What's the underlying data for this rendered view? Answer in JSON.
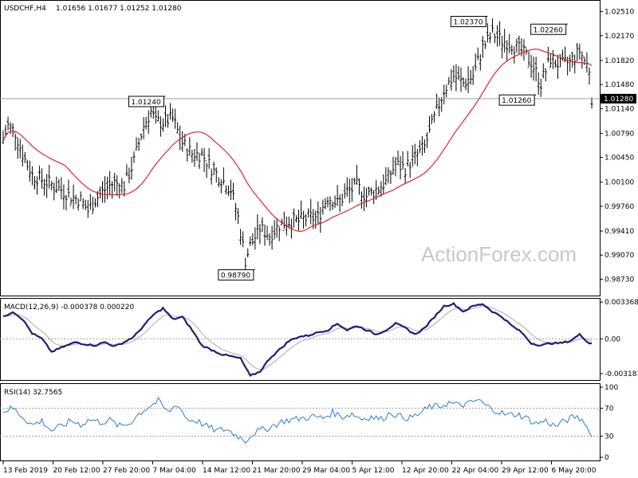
{
  "chart_data": {
    "type": "ohlc",
    "symbol_label": "USDCHF,H4",
    "ohlc_label": "1.01656 1.01677 1.01252 1.01280",
    "watermark": "ActionForex.com",
    "colors": {
      "bars": "#000000",
      "ma": "#e0262b",
      "macd": "#1c1c78",
      "signal": "#aaaaaa",
      "rsi": "#2c7cd6",
      "grid": "#a0a0a0"
    },
    "x_labels": [
      "13 Feb 2019",
      "20 Feb 12:00",
      "27 Feb 20:00",
      "7 Mar 04:00",
      "14 Mar 12:00",
      "21 Mar 20:00",
      "29 Mar 04:00",
      "5 Apr 12:00",
      "12 Apr 20:00",
      "22 Apr 04:00",
      "29 Apr 12:00",
      "6 May 20:00"
    ],
    "price": {
      "ylim": [
        0.9851,
        1.0264
      ],
      "tick_labels": [
        "1.02510",
        "1.02170",
        "1.01820",
        "1.01480",
        "1.01140",
        "1.00790",
        "1.00450",
        "1.00100",
        "0.99760",
        "0.99410",
        "0.99070",
        "0.98730"
      ],
      "last_label": "1.01280",
      "last_value": 1.0128,
      "anchors": [
        [
          0,
          1.007
        ],
        [
          2,
          1.009
        ],
        [
          5,
          1.008
        ],
        [
          8,
          1.005
        ],
        [
          12,
          1.002
        ],
        [
          18,
          1.001
        ],
        [
          24,
          1.0
        ],
        [
          28,
          0.999
        ],
        [
          32,
          0.9985
        ],
        [
          35,
          0.997
        ],
        [
          38,
          0.9985
        ],
        [
          42,
          1.0
        ],
        [
          46,
          1.001
        ],
        [
          50,
          1.0005
        ],
        [
          54,
          1.004
        ],
        [
          58,
          1.009
        ],
        [
          61,
          1.011
        ],
        [
          63,
          1.0095
        ],
        [
          66,
          1.0095
        ],
        [
          70,
          1.01
        ],
        [
          74,
          1.0065
        ],
        [
          78,
          1.005
        ],
        [
          82,
          1.005
        ],
        [
          86,
          1.003
        ],
        [
          90,
          1.0015
        ],
        [
          94,
          1.0
        ],
        [
          97,
          0.996
        ],
        [
          100,
          0.99
        ],
        [
          102,
          0.992
        ],
        [
          106,
          0.9945
        ],
        [
          110,
          0.9935
        ],
        [
          114,
          0.995
        ],
        [
          118,
          0.9955
        ],
        [
          122,
          0.9955
        ],
        [
          126,
          0.996
        ],
        [
          130,
          0.996
        ],
        [
          134,
          0.999
        ],
        [
          138,
          0.998
        ],
        [
          142,
          0.9995
        ],
        [
          146,
          1.0005
        ],
        [
          150,
          0.999
        ],
        [
          154,
          1.0
        ],
        [
          158,
          1.001
        ],
        [
          162,
          1.0035
        ],
        [
          166,
          1.003
        ],
        [
          170,
          1.0045
        ],
        [
          174,
          1.006
        ],
        [
          178,
          1.01
        ],
        [
          182,
          1.014
        ],
        [
          186,
          1.016
        ],
        [
          190,
          1.015
        ],
        [
          194,
          1.016
        ],
        [
          198,
          1.02
        ],
        [
          202,
          1.022
        ],
        [
          206,
          1.021
        ],
        [
          210,
          1.0205
        ],
        [
          214,
          1.0195
        ],
        [
          218,
          1.018
        ],
        [
          222,
          1.015
        ],
        [
          226,
          1.0185
        ],
        [
          230,
          1.0175
        ],
        [
          234,
          1.018
        ],
        [
          238,
          1.0195
        ],
        [
          242,
          1.017
        ],
        [
          243,
          1.013
        ]
      ],
      "annotations": [
        {
          "text": "1.02370",
          "value": 1.0237,
          "bar": 200,
          "side": "left"
        },
        {
          "text": "1.02260",
          "value": 1.0226,
          "bar": 233,
          "side": "left"
        },
        {
          "text": "1.01240",
          "value": 1.0124,
          "bar": 67,
          "side": "left"
        },
        {
          "text": "1.01260",
          "value": 1.0126,
          "bar": 220,
          "side": "left"
        },
        {
          "text": "0.98790",
          "value": 0.9879,
          "bar": 104,
          "side": "left"
        }
      ]
    },
    "macd": {
      "title": "MACD(12,26,9) -0.000378 0.000220",
      "ylim": [
        -0.0037,
        0.0036
      ],
      "tick_labels": [
        "0.003368",
        "0.00",
        "-0.003181"
      ],
      "tick_values": [
        0.003368,
        0.0,
        -0.003181
      ],
      "zero_label": "0.00",
      "anchors": [
        [
          0,
          0.002
        ],
        [
          4,
          0.0025
        ],
        [
          8,
          0.0018
        ],
        [
          12,
          0.0005
        ],
        [
          16,
          0.0
        ],
        [
          20,
          -0.0012
        ],
        [
          24,
          -0.0008
        ],
        [
          30,
          -0.0003
        ],
        [
          34,
          -0.0005
        ],
        [
          38,
          -0.0006
        ],
        [
          42,
          -0.0003
        ],
        [
          46,
          -0.0007
        ],
        [
          50,
          -0.0003
        ],
        [
          54,
          0.0002
        ],
        [
          58,
          0.0012
        ],
        [
          62,
          0.0022
        ],
        [
          66,
          0.0028
        ],
        [
          70,
          0.0018
        ],
        [
          74,
          0.002
        ],
        [
          78,
          0.0008
        ],
        [
          82,
          -0.0006
        ],
        [
          86,
          -0.001
        ],
        [
          90,
          -0.0014
        ],
        [
          94,
          -0.0016
        ],
        [
          98,
          -0.0018
        ],
        [
          102,
          -0.0034
        ],
        [
          106,
          -0.003
        ],
        [
          110,
          -0.0018
        ],
        [
          114,
          -0.001
        ],
        [
          118,
          -0.0002
        ],
        [
          122,
          0.0002
        ],
        [
          126,
          0.0003
        ],
        [
          130,
          0.0006
        ],
        [
          134,
          0.0008
        ],
        [
          138,
          0.0014
        ],
        [
          142,
          0.0008
        ],
        [
          146,
          0.0012
        ],
        [
          150,
          0.0008
        ],
        [
          154,
          0.0004
        ],
        [
          158,
          0.0008
        ],
        [
          162,
          0.0014
        ],
        [
          166,
          0.001
        ],
        [
          170,
          0.0004
        ],
        [
          174,
          0.001
        ],
        [
          178,
          0.002
        ],
        [
          182,
          0.003
        ],
        [
          186,
          0.0032
        ],
        [
          190,
          0.0025
        ],
        [
          194,
          0.003
        ],
        [
          198,
          0.0032
        ],
        [
          202,
          0.0025
        ],
        [
          206,
          0.002
        ],
        [
          210,
          0.0012
        ],
        [
          214,
          0.0006
        ],
        [
          218,
          -0.0004
        ],
        [
          222,
          -0.0006
        ],
        [
          226,
          -0.0004
        ],
        [
          230,
          -0.0004
        ],
        [
          234,
          -0.0002
        ],
        [
          238,
          0.0004
        ],
        [
          242,
          -0.0004
        ]
      ]
    },
    "rsi": {
      "title": "RSI(14) 32.7565",
      "ylim": [
        0,
        100
      ],
      "tick_labels": [
        "100",
        "70",
        "30",
        "0"
      ],
      "tick_values": [
        100,
        70,
        30,
        0
      ],
      "levels": [
        70,
        30
      ],
      "anchors": [
        [
          0,
          66
        ],
        [
          4,
          70
        ],
        [
          8,
          58
        ],
        [
          12,
          46
        ],
        [
          16,
          52
        ],
        [
          20,
          38
        ],
        [
          24,
          44
        ],
        [
          28,
          52
        ],
        [
          32,
          47
        ],
        [
          36,
          54
        ],
        [
          40,
          50
        ],
        [
          44,
          53
        ],
        [
          48,
          44
        ],
        [
          52,
          48
        ],
        [
          56,
          62
        ],
        [
          60,
          72
        ],
        [
          64,
          80
        ],
        [
          68,
          64
        ],
        [
          72,
          76
        ],
        [
          76,
          54
        ],
        [
          80,
          52
        ],
        [
          84,
          44
        ],
        [
          88,
          38
        ],
        [
          92,
          40
        ],
        [
          96,
          32
        ],
        [
          100,
          24
        ],
        [
          104,
          36
        ],
        [
          108,
          40
        ],
        [
          112,
          46
        ],
        [
          116,
          52
        ],
        [
          120,
          54
        ],
        [
          124,
          56
        ],
        [
          128,
          58
        ],
        [
          132,
          56
        ],
        [
          136,
          64
        ],
        [
          140,
          58
        ],
        [
          144,
          62
        ],
        [
          148,
          55
        ],
        [
          152,
          58
        ],
        [
          156,
          54
        ],
        [
          160,
          64
        ],
        [
          164,
          58
        ],
        [
          168,
          56
        ],
        [
          172,
          62
        ],
        [
          176,
          72
        ],
        [
          180,
          72
        ],
        [
          184,
          78
        ],
        [
          188,
          74
        ],
        [
          192,
          76
        ],
        [
          196,
          82
        ],
        [
          200,
          72
        ],
        [
          204,
          66
        ],
        [
          208,
          60
        ],
        [
          212,
          62
        ],
        [
          216,
          56
        ],
        [
          220,
          48
        ],
        [
          224,
          52
        ],
        [
          228,
          44
        ],
        [
          232,
          52
        ],
        [
          236,
          58
        ],
        [
          240,
          52
        ],
        [
          242,
          34
        ]
      ]
    }
  }
}
